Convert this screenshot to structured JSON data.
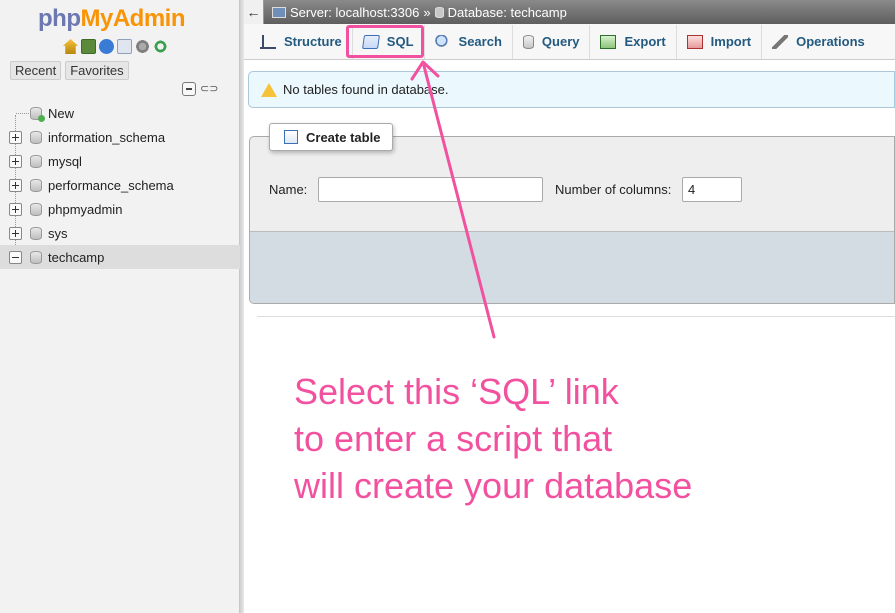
{
  "nav": {
    "logo": {
      "php": "php",
      "my": "My",
      "admin": "Admin"
    },
    "quick_icons": [
      "home-icon",
      "logout-icon",
      "help-icon",
      "docs-icon",
      "settings-icon",
      "reload-icon"
    ],
    "recent_label": "Recent",
    "favorites_label": "Favorites",
    "tree": [
      {
        "label": "New",
        "expander": "none"
      },
      {
        "label": "information_schema",
        "expander": "plus"
      },
      {
        "label": "mysql",
        "expander": "plus"
      },
      {
        "label": "performance_schema",
        "expander": "plus"
      },
      {
        "label": "phpmyadmin",
        "expander": "plus"
      },
      {
        "label": "sys",
        "expander": "plus"
      },
      {
        "label": "techcamp",
        "expander": "minus",
        "selected": true
      }
    ]
  },
  "breadcrumb": {
    "server": "Server: localhost:3306",
    "separator": "»",
    "database": "Database: techcamp"
  },
  "tabs": [
    {
      "label": "Structure",
      "icon": "structure-icon"
    },
    {
      "label": "SQL",
      "icon": "sql-icon"
    },
    {
      "label": "Search",
      "icon": "search-icon"
    },
    {
      "label": "Query",
      "icon": "query-icon"
    },
    {
      "label": "Export",
      "icon": "export-icon"
    },
    {
      "label": "Import",
      "icon": "import-icon"
    },
    {
      "label": "Operations",
      "icon": "operations-icon"
    }
  ],
  "notice": {
    "text": "No tables found in database."
  },
  "create_table": {
    "legend": "Create table",
    "name_label": "Name:",
    "name_value": "",
    "columns_label": "Number of columns:",
    "columns_value": "4"
  },
  "annotation": {
    "color": "#f2519f",
    "lines": [
      "Select this ‘SQL’ link",
      "to enter a script that",
      "will create your database"
    ]
  }
}
